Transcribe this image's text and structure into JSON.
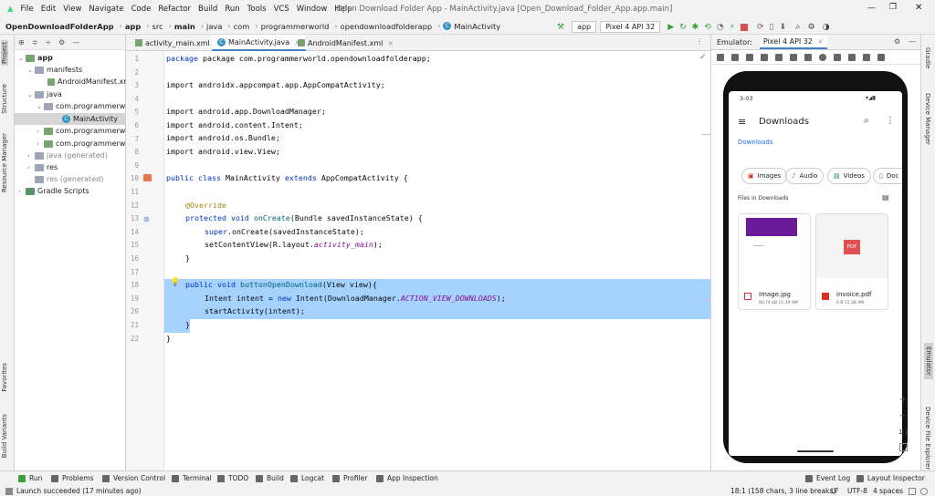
{
  "menu": [
    "File",
    "Edit",
    "View",
    "Navigate",
    "Code",
    "Refactor",
    "Build",
    "Run",
    "Tools",
    "VCS",
    "Window",
    "Help"
  ],
  "window_title": "Open Download Folder App - MainActivity.java [Open_Download_Folder_App.app.main]",
  "breadcrumbs": [
    "OpenDownloadFolderApp",
    "app",
    "src",
    "main",
    "java",
    "com",
    "programmerworld",
    "opendownloadfolderapp",
    "MainActivity"
  ],
  "run_config": "app",
  "device": "Pixel 4 API 32",
  "left_tabs": [
    "Project",
    "Structure",
    "Resource Manager",
    "Favorites",
    "Build Variants"
  ],
  "right_tabs": [
    "Gradle",
    "Device Manager",
    "Emulator",
    "Device File Explorer"
  ],
  "project_tree": [
    "app",
    "manifests",
    "AndroidManifest.xml",
    "java",
    "com.programmerwo",
    "MainActivity",
    "com.programmerwo",
    "com.programmerwo",
    "java (generated)",
    "res",
    "res (generated)",
    "Gradle Scripts"
  ],
  "editor_tabs": [
    "activity_main.xml",
    "MainActivity.java",
    "AndroidManifest.xml"
  ],
  "line_numbers": [
    "1",
    "2",
    "3",
    "4",
    "5",
    "6",
    "7",
    "8",
    "9",
    "10",
    "11",
    "12",
    "13",
    "14",
    "15",
    "16",
    "17",
    "18",
    "19",
    "20",
    "21",
    "22"
  ],
  "code": {
    "l1": "package com.programmerworld.opendownloadfolderapp;",
    "l3": "import androidx.appcompat.app.AppCompatActivity;",
    "l5": "import android.app.DownloadManager;",
    "l6": "import android.content.Intent;",
    "l7": "import android.os.Bundle;",
    "l8": "import android.view.View;",
    "l10a": "public class ",
    "l10b": "MainActivity ",
    "l10c": "extends ",
    "l10d": "AppCompatActivity {",
    "l12": "@Override",
    "l13a": "protected void ",
    "l13b": "onCreate",
    "l13c": "(Bundle savedInstanceState) {",
    "l14a": "super",
    "l14b": ".onCreate(savedInstanceState);",
    "l15a": "setContentView(R.layout.",
    "l15b": "activity_main",
    "l15c": ");",
    "l16": "}",
    "l18a": "public void ",
    "l18b": "buttonOpenDownload",
    "l18c": "(View view){",
    "l19a": "Intent intent = ",
    "l19b": "new ",
    "l19c": "Intent(DownloadManager.",
    "l19d": "ACTION_VIEW_DOWNLOADS",
    "l19e": ");",
    "l20": "startActivity(intent);",
    "l21": "}",
    "l22": "}"
  },
  "emulator": {
    "label": "Emulator:",
    "device_tab": "Pixel 4 API 32",
    "phone": {
      "time": "3:03",
      "title": "Downloads",
      "crumb": "Downloads",
      "chips": [
        "Images",
        "Audio",
        "Videos",
        "Doc"
      ],
      "section": "Files in Downloads",
      "files": [
        {
          "name": "Image.jpg",
          "meta": "80.74 kB 11:39 AM"
        },
        {
          "name": "invoice.pdf",
          "meta": "0 B 11:38 AM"
        }
      ],
      "pdf_badge": "PDF"
    },
    "zoom_labels": [
      "+",
      "−",
      "1:1"
    ]
  },
  "bottom_tools": [
    "Run",
    "Problems",
    "Version Control",
    "Terminal",
    "TODO",
    "Build",
    "Logcat",
    "Profiler",
    "App Inspection",
    "Event Log",
    "Layout Inspector"
  ],
  "status": {
    "message": "Launch succeeded (17 minutes ago)",
    "position": "18:1 (158 chars, 3 line breaks)",
    "line_sep": "LF",
    "encoding": "UTF-8",
    "indent": "4 spaces"
  }
}
